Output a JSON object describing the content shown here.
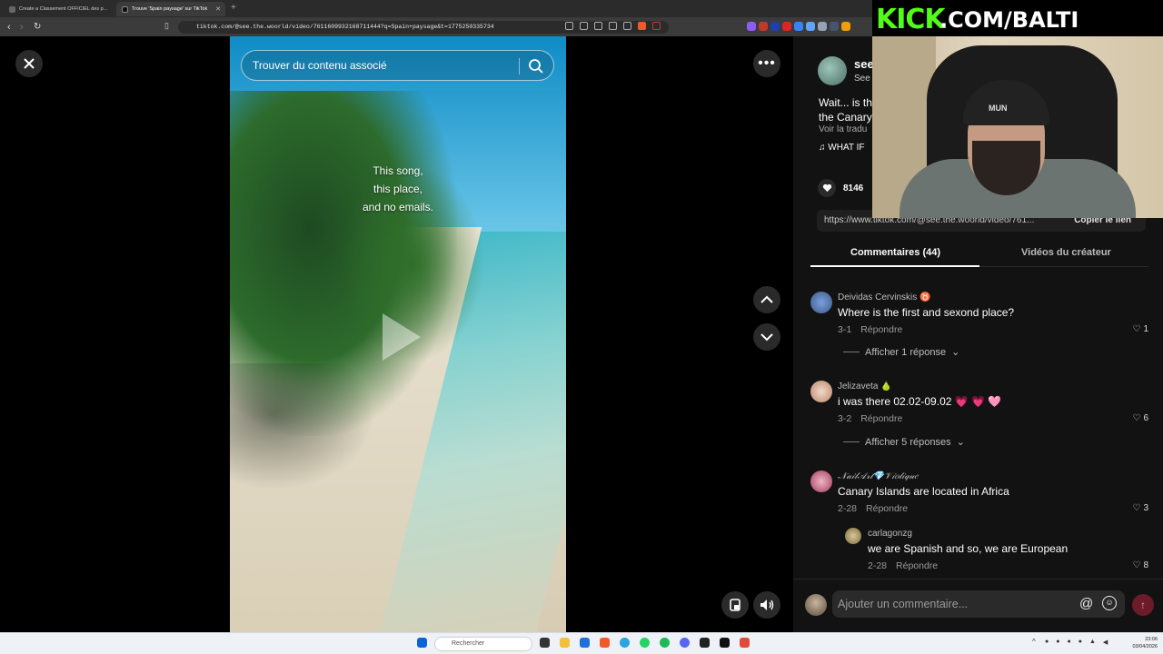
{
  "browser": {
    "tabs": [
      {
        "title": "Create a Classement OFFICIEL des p...",
        "active": false
      },
      {
        "title": "Trouve 'Spain paysage' sur TikTok",
        "active": true
      }
    ],
    "url": "tiktok.com/@see.the.woorld/video/7611609932168711444?q=Spain+paysage&t=1775250335734"
  },
  "stream_overlay": {
    "brand": "KICK",
    "handle": ".COM/BALTI",
    "beanie_text": "MUN"
  },
  "video": {
    "search_placeholder": "Trouver du contenu associé",
    "overlay_lines": [
      "This song,",
      "this place,",
      "and no emails."
    ]
  },
  "author": {
    "name": "see",
    "subtitle": "See",
    "description_lines": [
      "Wait... is th",
      "the Canary"
    ],
    "translate_link": "Voir la tradu",
    "music": "♫  WHAT IF"
  },
  "stats": {
    "likes": "8146"
  },
  "share": {
    "link": "https://www.tiktok.com/@see.the.woorld/video/761...",
    "copy_label": "Copier le lien"
  },
  "panel_tabs": {
    "comments": "Commentaires (44)",
    "creator_videos": "Vidéos du créateur"
  },
  "comments": [
    {
      "name": "Deividas Cervinskis ♉",
      "text": "Where is the first and sexond place?",
      "date": "3-1",
      "reply": "Répondre",
      "likes": "1",
      "replies_label": "Afficher 1 réponse"
    },
    {
      "name": "Jelizaveta 🍐",
      "text": "i was there 02.02-09.02 💗 💗 🩷",
      "date": "3-2",
      "reply": "Répondre",
      "likes": "6",
      "replies_label": "Afficher 5 réponses"
    },
    {
      "name": "𝒩𝒶𝒾𝓁𝒜𝓇𝓉💎𝒱𝒾𝑜𝓁𝒾𝓆𝓊𝑒",
      "text": "Canary Islands are located in Africa",
      "date": "2-28",
      "reply": "Répondre",
      "likes": "3"
    },
    {
      "name": "carlagonzg",
      "text": "we are Spanish and so, we are European",
      "date": "2-28",
      "reply": "Répondre",
      "likes": "8"
    }
  ],
  "composer": {
    "placeholder": "Ajouter un commentaire..."
  },
  "taskbar": {
    "search_placeholder": "Rechercher",
    "time": "23:06",
    "date": "03/04/2026"
  },
  "colors": {
    "kick_green": "#53fc18",
    "panel_bg": "#121212",
    "send_button": "#6b1c28"
  }
}
